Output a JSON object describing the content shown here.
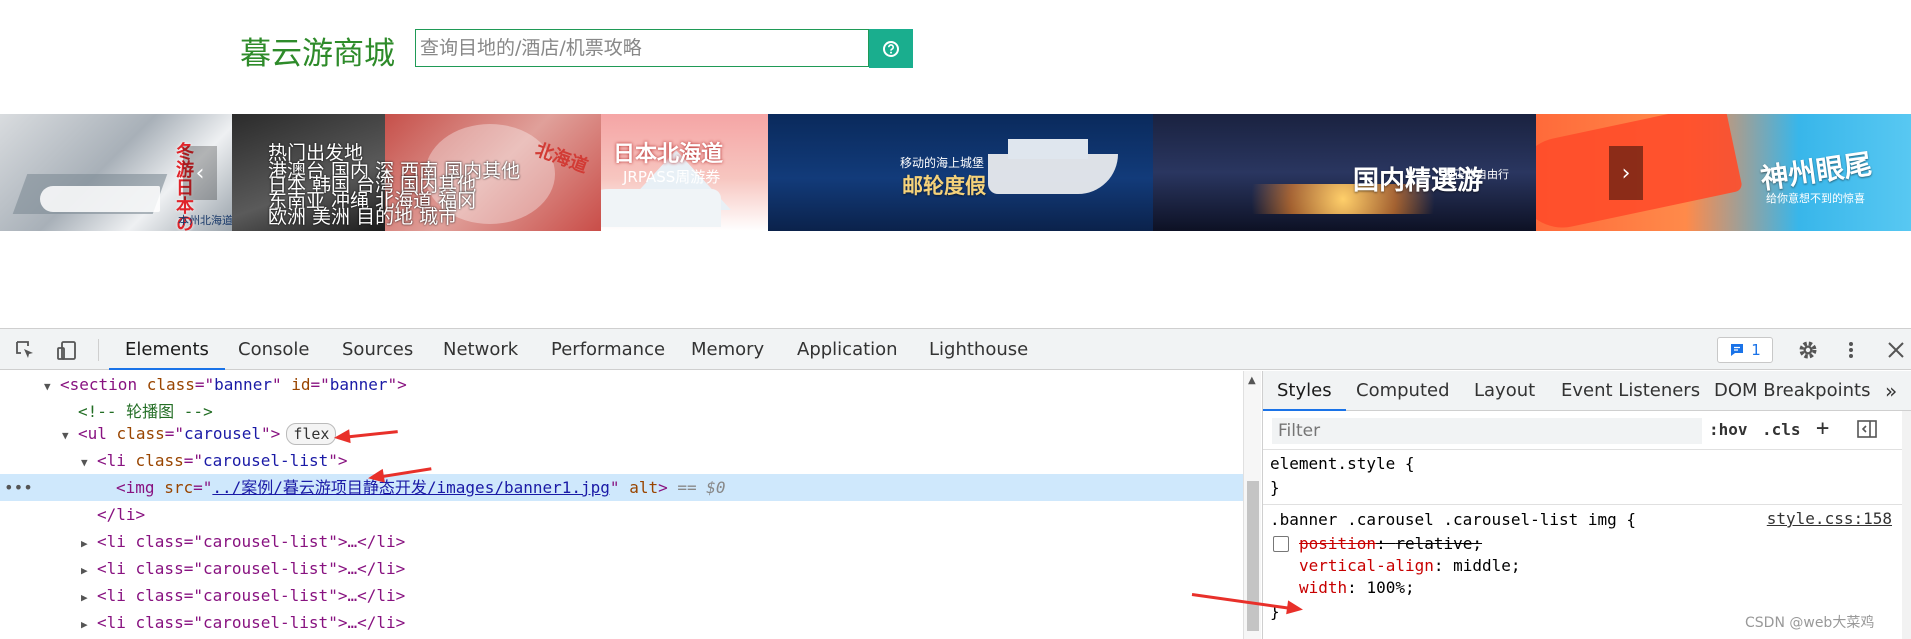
{
  "site": {
    "logo": "暮云游商城",
    "search_placeholder": "查询目地的/酒店/机票攻略",
    "search_icon": "question-circle-icon"
  },
  "banner": {
    "slides": [
      {
        "title": "冬游日本の絶景撮影",
        "sub": "本州北海道"
      },
      {
        "title": "",
        "sub": ""
      },
      {
        "title": "北海道",
        "sub": ""
      },
      {
        "title": "日本北海道",
        "sub": "JRPASS周游券"
      },
      {
        "title": "邮轮度假",
        "sub": "移动的海上城堡"
      },
      {
        "title": "国内精選游",
        "sub": "真正的自由行"
      },
      {
        "title": "神州眼尾",
        "sub": "给你意想不到的惊喜"
      }
    ],
    "overlay_lines": [
      "热门出发地",
      "港澳台 国内 深 西南 国内其他",
      "日本 韩国 台湾 国内其他",
      "东南亚 冲绳 北海道 福冈",
      "欧洲 美洲 目的地 城市"
    ],
    "prev_icon": "chevron-left-icon",
    "next_icon": "chevron-right-icon"
  },
  "devtools": {
    "tabs": [
      "Elements",
      "Console",
      "Sources",
      "Network",
      "Performance",
      "Memory",
      "Application",
      "Lighthouse"
    ],
    "active_tab": "Elements",
    "issues_count": "1",
    "dom": {
      "section_open": {
        "tag": "section",
        "attr1": "class",
        "val1": "banner",
        "attr2": "id",
        "val2": "banner"
      },
      "comment": "<!-- 轮播图 -->",
      "ul": {
        "tag": "ul",
        "attr": "class",
        "val": "carousel",
        "badge": "flex"
      },
      "li": {
        "tag": "li",
        "attr": "class",
        "val": "carousel-list"
      },
      "img": {
        "tag": "img",
        "attr_src": "src",
        "src": "../案例/暮云游项目静态开发/images/banner1.jpg",
        "attr_alt": "alt",
        "marker": "== $0"
      },
      "li_close": "</li>",
      "collapsed_li_label": "<li class=\"carousel-list\">…</li>"
    },
    "styles": {
      "tabs": [
        "Styles",
        "Computed",
        "Layout",
        "Event Listeners",
        "DOM Breakpoints"
      ],
      "active_tab": "Styles",
      "filter_placeholder": "Filter",
      "hov": ":hov",
      "cls": ".cls",
      "element_style": "element.style {",
      "close_brace": "}",
      "selector": ".banner .carousel .carousel-list img {",
      "source": "style.css:158",
      "props": [
        {
          "name": "position",
          "value": "relative;",
          "struck": true
        },
        {
          "name": "vertical-align",
          "value": "middle;",
          "struck": false
        },
        {
          "name": "width",
          "value": "100%;",
          "struck": false
        }
      ]
    }
  },
  "watermark": "CSDN @web大菜鸡"
}
